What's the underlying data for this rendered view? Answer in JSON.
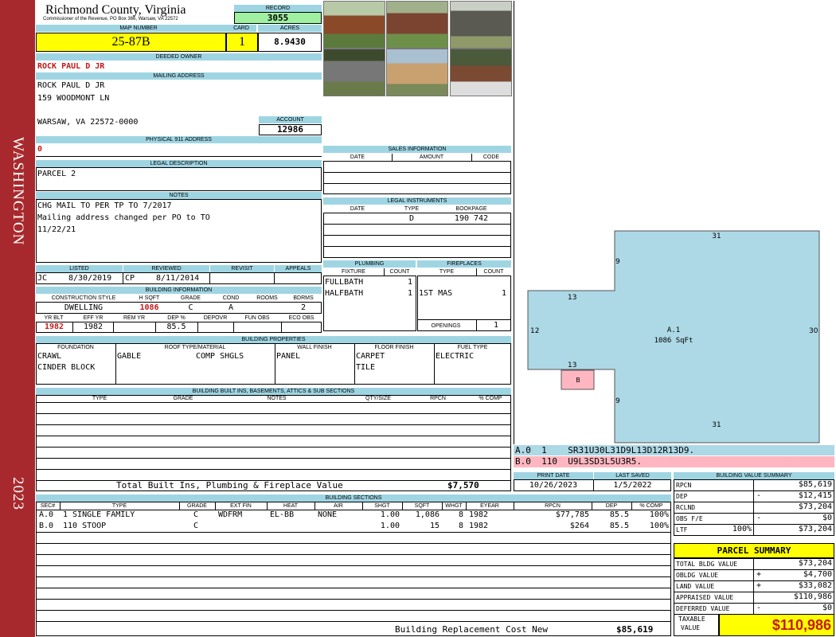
{
  "side": {
    "bottom": "WASHINGTON",
    "top": "2023"
  },
  "header": {
    "county": "Richmond County, Virginia",
    "commissioner": "Commissioner of the Revenue, PO Box 366, Warsaw, VA 22572",
    "record_label": "RECORD",
    "record": "3055",
    "map_label": "MAP NUMBER",
    "map": "25-87B",
    "card_label": "CARD",
    "card": "1",
    "acres_label": "ACRES",
    "acres": "8.9430"
  },
  "owner": {
    "label": "DEEDED OWNER",
    "name": "ROCK PAUL D JR",
    "mail_label": "MAILING ADDRESS",
    "mail1": "ROCK PAUL D JR",
    "mail2": "159 WOODMONT LN",
    "mail3": "WARSAW, VA 22572-0000",
    "account_label": "ACCOUNT",
    "account": "12986",
    "phys_label": "PHYSICAL 911 ADDRESS",
    "phys": "0"
  },
  "legal": {
    "label": "LEGAL DESCRIPTION",
    "text": "PARCEL 2"
  },
  "notes": {
    "label": "NOTES",
    "l1": "CHG MAIL TO PER TP TO 7/2017",
    "l2": "Mailing address changed per PO to TO",
    "l3": "11/22/21"
  },
  "status": {
    "listed_label": "LISTED",
    "reviewed_label": "REVIEWED",
    "revisit_label": "REVISIT",
    "appeals_label": "APPEALS",
    "listed_by": "JC",
    "listed_date": "8/30/2019",
    "reviewed_by": "CP",
    "reviewed_date": "8/11/2014"
  },
  "bldg_info": {
    "label": "BUILDING INFORMATION",
    "cs_label": "CONSTRUCTION STYLE",
    "hsqft_label": "H SQFT",
    "grade_label": "GRADE",
    "cond_label": "COND",
    "rooms_label": "ROOMS",
    "bdrms_label": "BDRMS",
    "style": "DWELLING",
    "hsqft": "1086",
    "grade": "C",
    "cond": "A",
    "rooms": "",
    "bdrms": "2",
    "yrblt_label": "YR BLT",
    "effyr_label": "EFF YR",
    "remyr_label": "REM YR",
    "dep_label": "DEP %",
    "depovr_label": "DEPOVR",
    "funobs_label": "FUN OBS",
    "ecoobs_label": "ECO OBS",
    "yrblt": "1982",
    "effyr": "1982",
    "dep": "85.5"
  },
  "sales": {
    "label": "SALES INFORMATION",
    "date": "DATE",
    "amount": "AMOUNT",
    "code": "CODE"
  },
  "instruments": {
    "label": "LEGAL INSTRUMENTS",
    "date": "DATE",
    "type": "TYPE",
    "bookpage": "BOOKPAGE",
    "r_type": "D",
    "r_book": "190 742"
  },
  "plumbing": {
    "label": "PLUMBING",
    "fixture": "FIXTURE",
    "count": "COUNT",
    "rows": [
      {
        "f": "FULLBATH",
        "c": "1"
      },
      {
        "f": "HALFBATH",
        "c": "1"
      }
    ]
  },
  "fireplaces": {
    "label": "FIREPLACES",
    "type": "TYPE",
    "count": "COUNT",
    "r_type": "1ST MAS",
    "r_count": "1",
    "openings_label": "OPENINGS",
    "openings": "1"
  },
  "props": {
    "label": "BUILDING PROPERTIES",
    "foundation": "FOUNDATION",
    "roof": "ROOF TYPE/MATERIAL",
    "wall": "WALL FINISH",
    "floor": "FLOOR FINISH",
    "fuel": "FUEL TYPE",
    "f1": "CRAWL",
    "f2": "CINDER BLOCK",
    "roof1": "GABLE",
    "roof2": "COMP SHGLS",
    "wall1": "PANEL",
    "floor1": "CARPET",
    "floor2": "TILE",
    "fuel1": "ELECTRIC"
  },
  "builtins": {
    "label": "BUILDING BUILT INS, BASEMENTS, ATTICS & SUB SECTIONS",
    "type": "TYPE",
    "grade": "GRADE",
    "notes": "NOTES",
    "qty": "QTY/SIZE",
    "rpcn": "RPCN",
    "comp": "% COMP",
    "total_label": "Total Built Ins, Plumbing & Fireplace Value",
    "total": "$7,570"
  },
  "dates": {
    "print_label": "PRINT DATE",
    "print": "10/26/2023",
    "saved_label": "LAST SAVED",
    "saved": "1/5/2022"
  },
  "sketch": {
    "area_label": "A.1",
    "area_sqft": "1086 SqFt",
    "b_label": "B",
    "dims": {
      "top": "31",
      "bottom": "31",
      "left_upper": "9",
      "left_lower": "9",
      "right": "30",
      "leftmost": "12",
      "notch_top": "13",
      "notch_bottom": "13"
    },
    "line_a": "A.0  1    SR31U30L31D9L13D12R13D9.",
    "line_b": "B.0  110  U9L3SD3L5U3R5.",
    "color_a": "#add8e6",
    "color_b": "#ffb6c1"
  },
  "sections": {
    "label": "BUILDING SECTIONS",
    "cols": [
      "SEC#",
      "TYPE",
      "GRADE",
      "EXT FIN",
      "HEAT",
      "AIR",
      "SHGT",
      "SQFT",
      "WHGT",
      "EYEAR",
      "RPCN",
      "DEP",
      "% COMP"
    ],
    "rows": [
      {
        "sec": "A.0",
        "type": "1 SINGLE FAMILY",
        "grade": "C",
        "ext": "WDFRM",
        "heat": "EL-BB",
        "air": "NONE",
        "shgt": "1.00",
        "sqft": "1,086",
        "whgt": "8",
        "eyear": "1982",
        "rpcn": "$77,785",
        "dep": "85.5",
        "comp": "100%"
      },
      {
        "sec": "B.0",
        "type": "110 STOOP",
        "grade": "C",
        "ext": "",
        "heat": "",
        "air": "",
        "shgt": "1.00",
        "sqft": "15",
        "whgt": "8",
        "eyear": "1982",
        "rpcn": "$264",
        "dep": "85.5",
        "comp": "100%"
      }
    ],
    "total_label": "Building Replacement Cost New",
    "total": "$85,619"
  },
  "bvs": {
    "label": "BUILDING VALUE SUMMARY",
    "rows": [
      {
        "k": "RPCN",
        "s": "",
        "v": "$85,619"
      },
      {
        "k": "DEP",
        "s": "-",
        "v": "$12,415"
      },
      {
        "k": "RCLND",
        "s": "",
        "v": "$73,204"
      },
      {
        "k": "OBS F/E",
        "s": "-",
        "v": "$0"
      },
      {
        "k": "LTF",
        "m": "100%",
        "s": "",
        "v": "$73,204"
      }
    ]
  },
  "summary": {
    "label": "PARCEL SUMMARY",
    "rows": [
      {
        "k": "TOTAL BLDG VALUE",
        "s": "",
        "v": "$73,204"
      },
      {
        "k": "OBLDG VALUE",
        "s": "+",
        "v": "$4,700"
      },
      {
        "k": "LAND VALUE",
        "s": "+",
        "v": "$33,082"
      },
      {
        "k": "APPRAISED VALUE",
        "s": "",
        "v": "$110,986"
      },
      {
        "k": "DEFERRED VALUE",
        "s": "-",
        "v": "$0"
      }
    ],
    "taxable_label1": "TAXABLE",
    "taxable_label2": "VALUE",
    "taxable": "$110,986"
  },
  "colors": {
    "header_blue": "#9fd5e3",
    "highlight": "#ffff00",
    "record_green": "#9ff0a0",
    "side_red": "#a8292d"
  }
}
